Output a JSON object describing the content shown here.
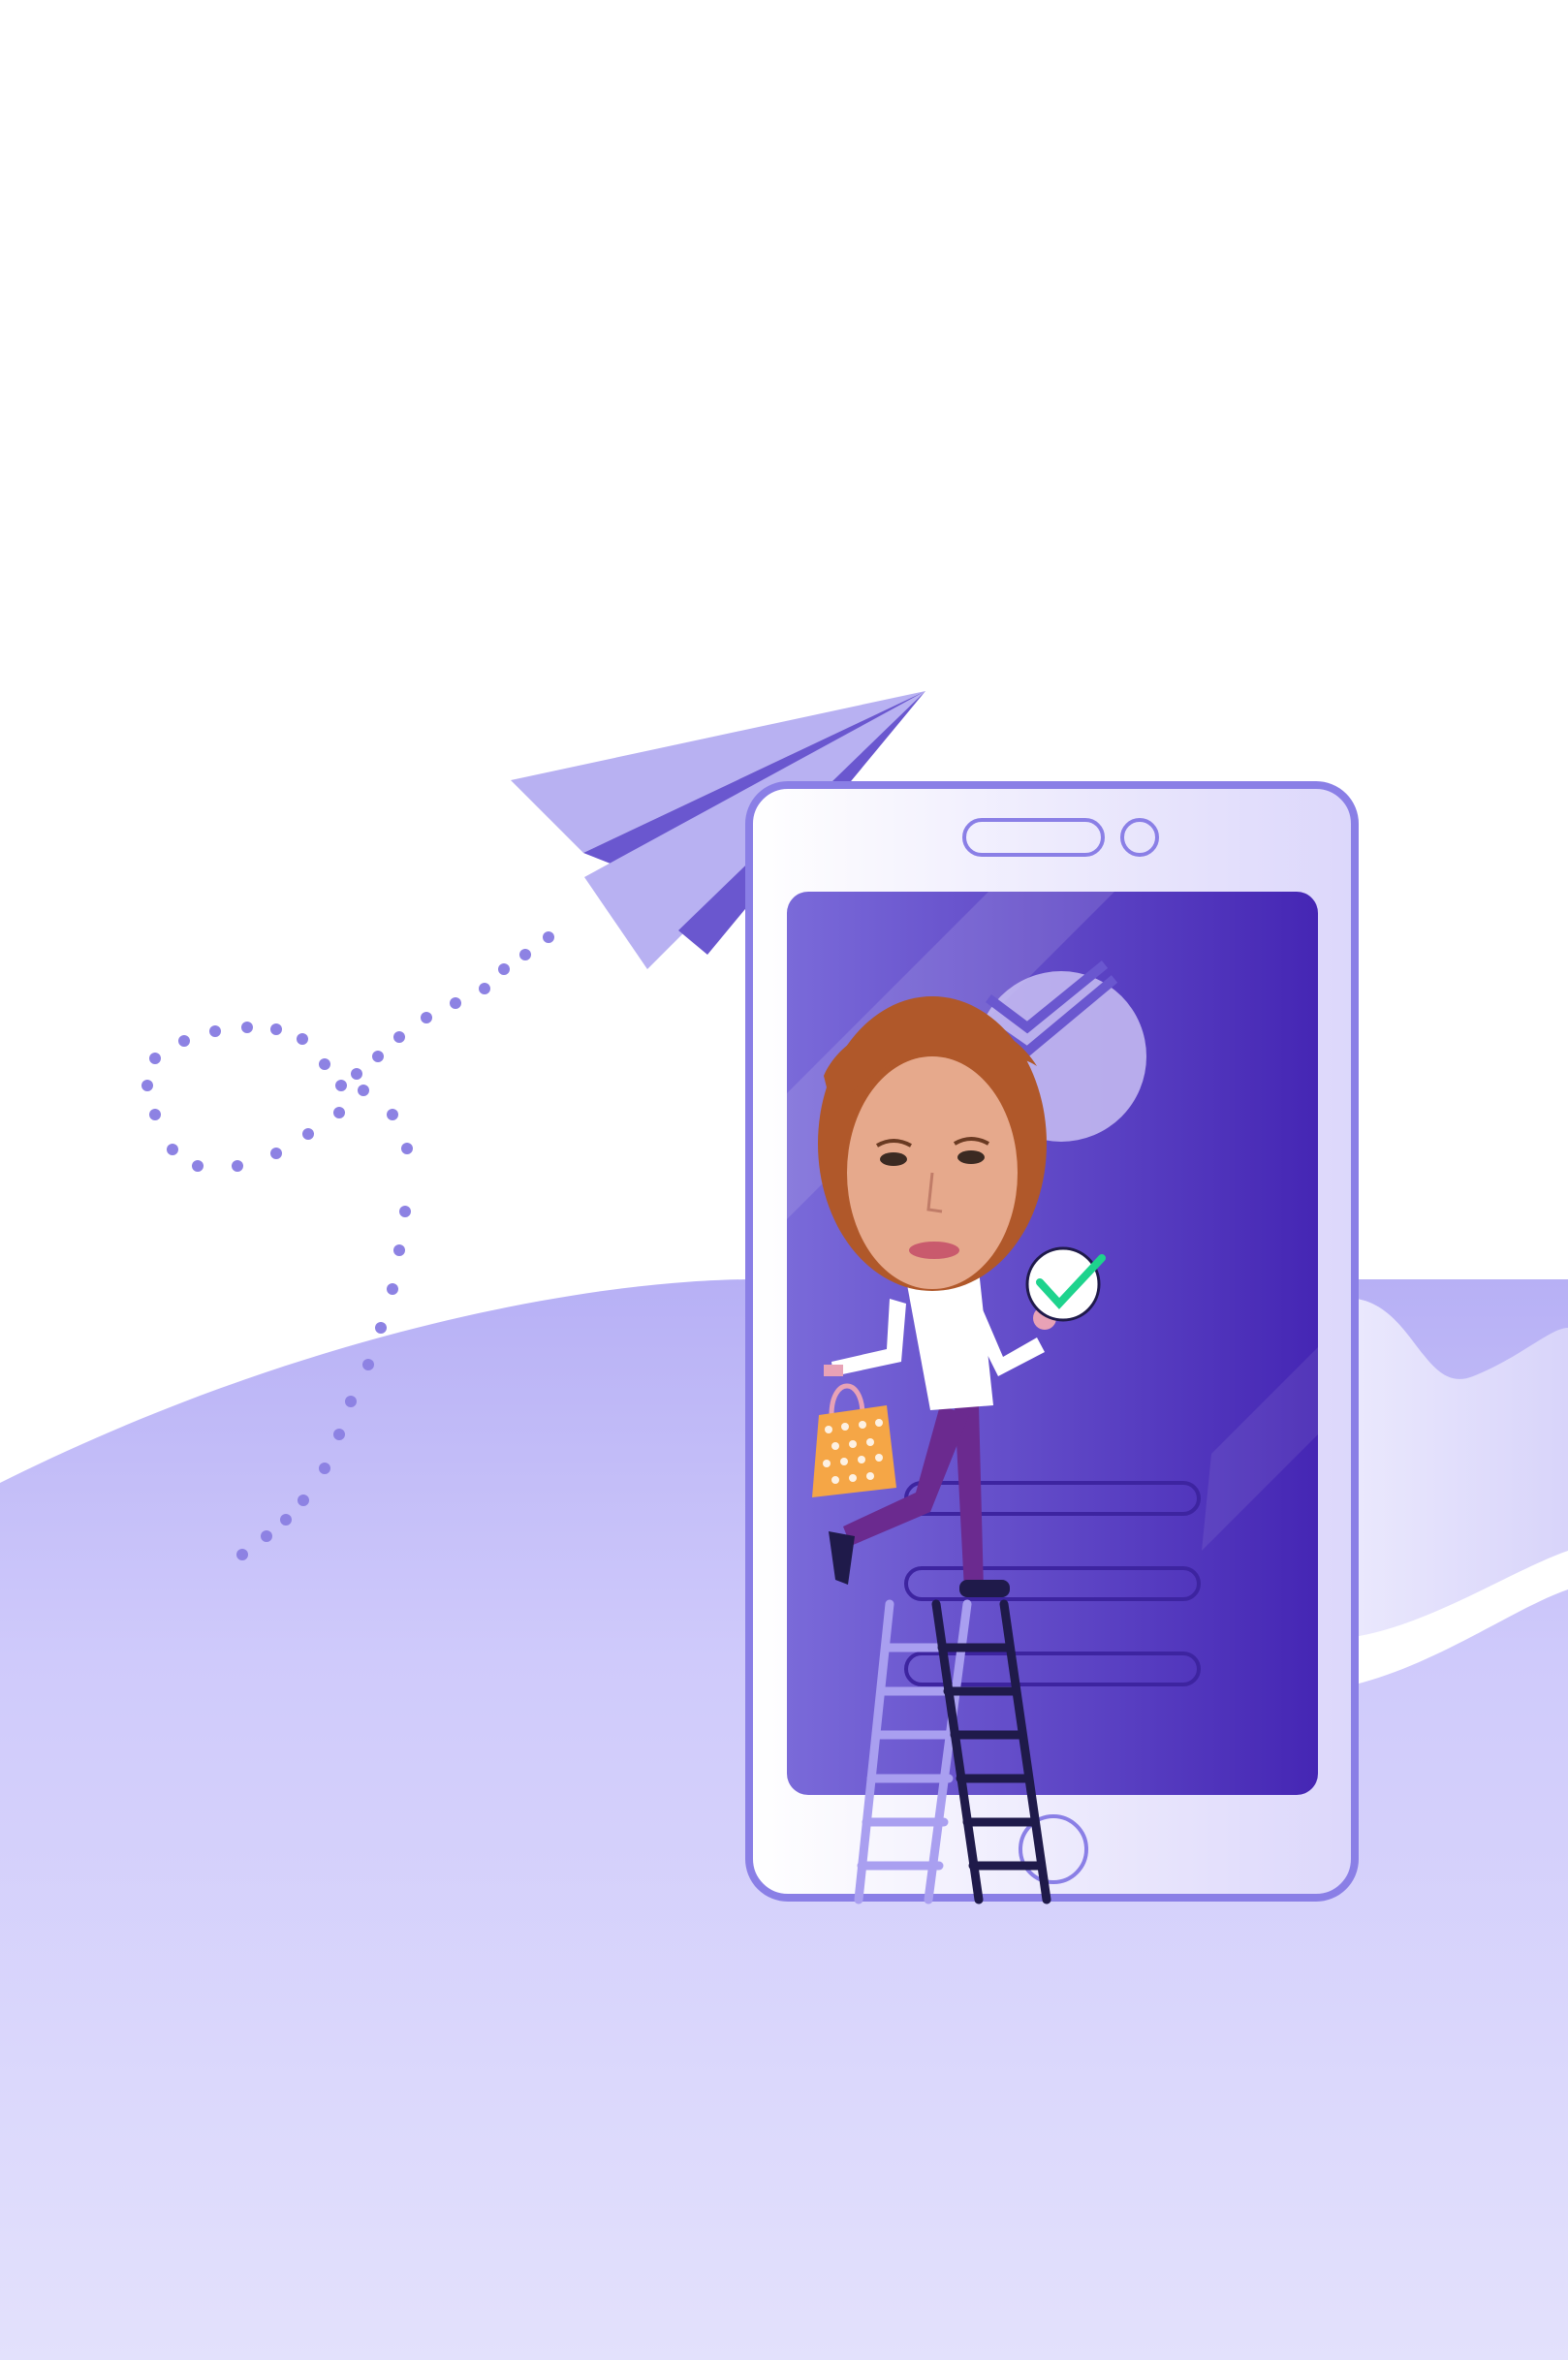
{
  "illustration": {
    "colors": {
      "background": "#ffffff",
      "wave_light": "#dcdafb",
      "wave_mid": "#b9b3f5",
      "phone_frame": "#8a7fe6",
      "phone_body": "#f4f2ff",
      "screen_dark": "#4a2fb9",
      "screen_light": "#7565d8",
      "plane_light": "#b8b1f2",
      "plane_dark": "#6a57cf",
      "dots": "#8d82e3",
      "ladder_light": "#a99ff0",
      "ladder_dark": "#1f1a4a",
      "shirt": "#ffffff",
      "pants": "#6b2a8f",
      "skin": "#e8a2b6",
      "hair": "#b0582a",
      "bag": "#f5a646",
      "check": "#1ed38d"
    },
    "icons": [
      "paper-plane-icon",
      "checkmark-icon",
      "bank-logo-icon",
      "shopping-bag-icon",
      "ladder-icon"
    ]
  }
}
